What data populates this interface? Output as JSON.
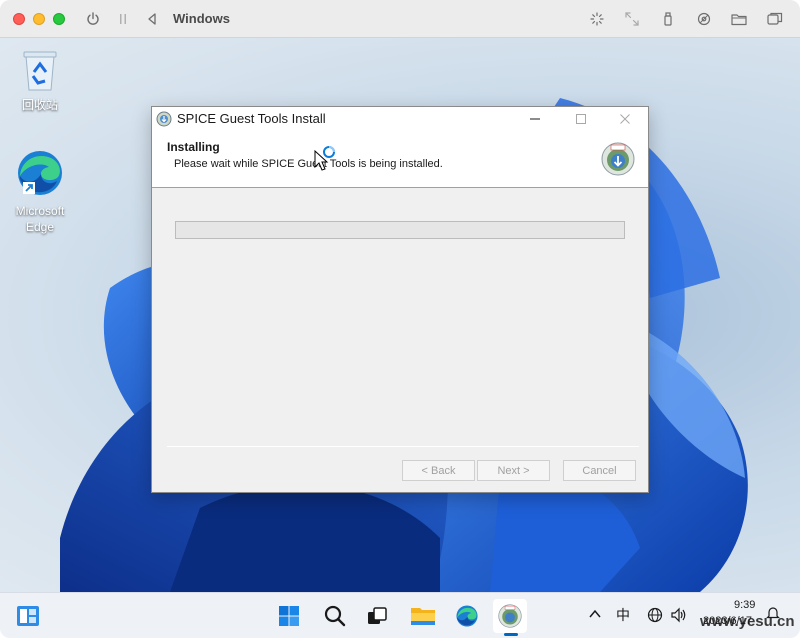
{
  "host": {
    "title": "Windows",
    "icons": [
      "power-icon",
      "pause-icon",
      "back-icon",
      "brightness-icon",
      "resize-icon",
      "usb-icon",
      "disk-icon",
      "folder-icon",
      "windows-icon"
    ]
  },
  "desktop": {
    "icons": [
      {
        "name": "recycle-bin-icon",
        "label": "回收站"
      },
      {
        "name": "microsoft-edge-icon",
        "label": "Microsoft Edge"
      }
    ]
  },
  "dialog": {
    "title": "SPICE Guest Tools Install",
    "header_title": "Installing",
    "header_subtitle": "Please wait while SPICE Guest Tools is being installed.",
    "progress": 0,
    "buttons": {
      "back": "< Back",
      "next": "Next >",
      "cancel": "Cancel"
    }
  },
  "taskbar": {
    "apps": [
      "widgets-icon",
      "start-icon",
      "search-icon",
      "task-view-icon",
      "file-explorer-icon",
      "edge-icon",
      "spice-installer-icon"
    ],
    "tray": {
      "ime": "中",
      "time": "9:39",
      "date": "2023/6/17"
    }
  },
  "watermark": "www.yesu.cn",
  "colors": {
    "accent": "#0067c0",
    "desktop_bloom": "#1a5fd6"
  }
}
